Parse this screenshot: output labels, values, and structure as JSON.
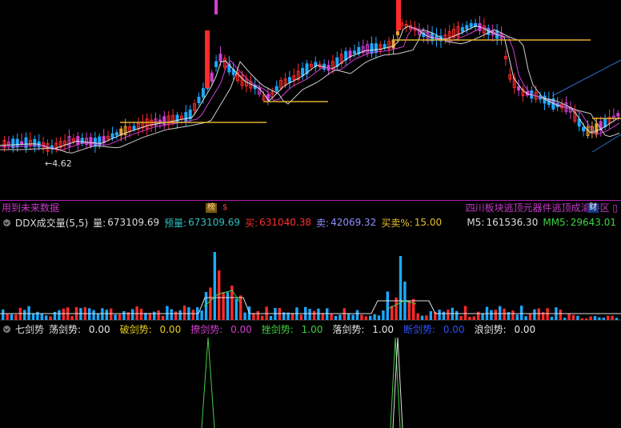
{
  "price": {
    "low_marker": "←4.62",
    "strip_left": "用到未来数据",
    "strip_right": "四川板块逃顶元器件逃顶成渝特区 ▯",
    "badge_bang": "榜",
    "badge_dollar": "$",
    "badge_cai": "财"
  },
  "ddx": {
    "title": "DDX成交量(5,5)",
    "vol_label": "量:",
    "vol_value": "673109.69",
    "pred_label": "预量:",
    "pred_value": "673109.69",
    "buy_label": "买:",
    "buy_value": "631040.38",
    "sell_label": "卖:",
    "sell_value": "42069.32",
    "ratio_label": "买卖%:",
    "ratio_value": "15.00",
    "m5_label": "M5:",
    "m5_value": "161536.30",
    "mm5_label": "MM5:",
    "mm5_value": "29643.01"
  },
  "sword": {
    "title": "七剑势",
    "items": [
      {
        "label": "荡剑势:",
        "value": "0.00",
        "color": "#e8e8e8"
      },
      {
        "label": "破剑势:",
        "value": "0.00",
        "color": "#e8d020"
      },
      {
        "label": "撩剑势:",
        "value": "0.00",
        "color": "#d040d0"
      },
      {
        "label": "挫剑势:",
        "value": "1.00",
        "color": "#40d040"
      },
      {
        "label": "落剑势:",
        "value": "1.00",
        "color": "#e8e8e8"
      },
      {
        "label": "断剑势:",
        "value": "0.00",
        "color": "#3050ff"
      },
      {
        "label": "浪剑势:",
        "value": "0.00",
        "color": "#e8e8e8"
      }
    ]
  },
  "colors": {
    "up": "#ff2a2a",
    "down": "#1ca9ff",
    "magenta": "#d040d0",
    "orange": "#f0a030",
    "gold": "#e0b030"
  }
}
